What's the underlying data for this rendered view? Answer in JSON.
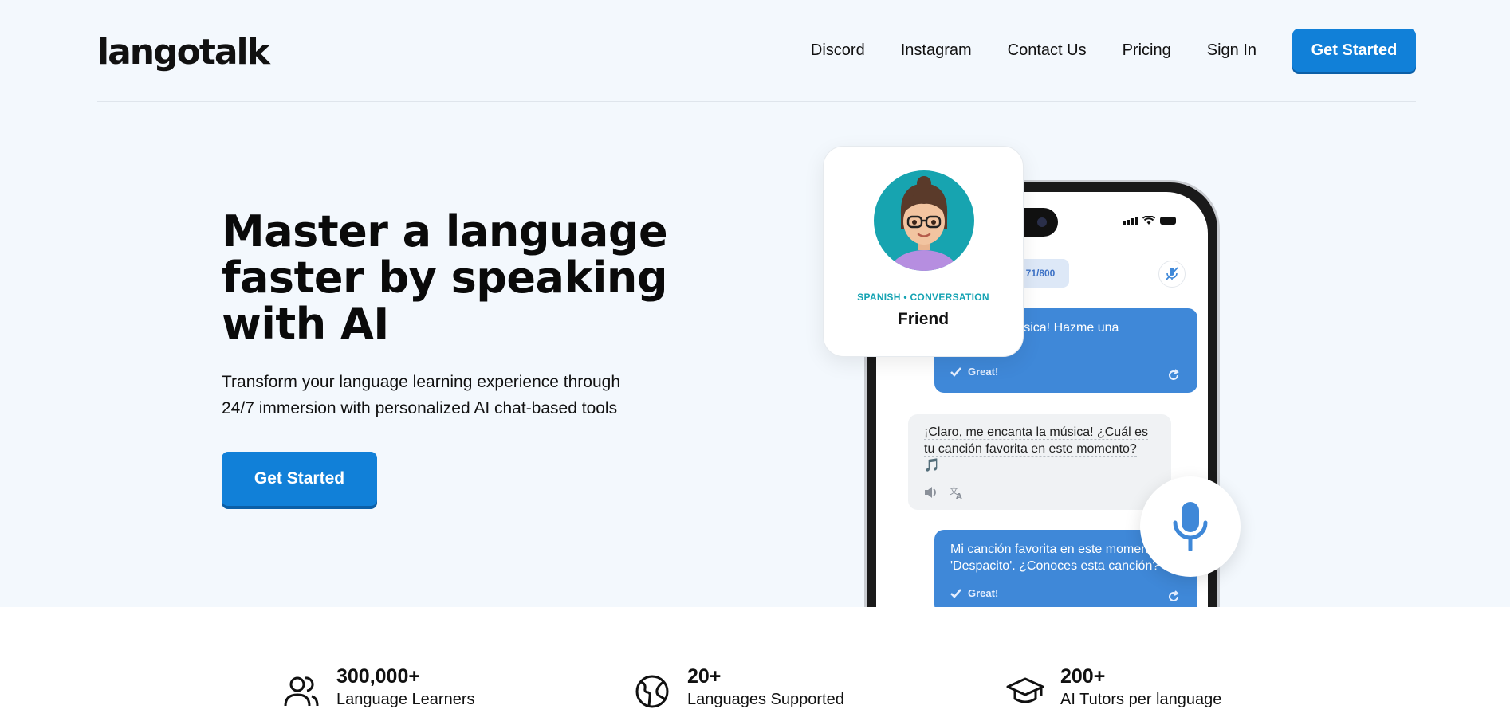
{
  "brand": {
    "logo": "langotalk"
  },
  "nav": {
    "links": [
      "Discord",
      "Instagram",
      "Contact Us",
      "Pricing",
      "Sign In"
    ],
    "cta": "Get Started"
  },
  "hero": {
    "headline": [
      "Master a language",
      "faster by speaking",
      "with AI"
    ],
    "subtitle": [
      "Transform your language learning experience through",
      "24/7 immersion with personalized AI chat-based tools"
    ],
    "cta": "Get Started"
  },
  "profile_card": {
    "tag": "SPANISH  •  CONVERSATION",
    "title": "Friend"
  },
  "phone": {
    "counter": "71/800",
    "messages": [
      {
        "role": "user",
        "text": "música! Hazme una",
        "feedback": "Great!"
      },
      {
        "role": "ai",
        "lines": [
          "¡Claro, me encanta la música! ¿Cuál es",
          "tu canción favorita en este momento?",
          "🎵"
        ]
      },
      {
        "role": "user",
        "lines": [
          "Mi canción favorita en este momen",
          "'Despacito'. ¿Conoces esta canción?"
        ],
        "feedback": "Great!"
      }
    ]
  },
  "stats": [
    {
      "value": "300,000+",
      "label": "Language Learners",
      "icon": "users-icon"
    },
    {
      "value": "20+",
      "label": "Languages Supported",
      "icon": "globe-icon"
    },
    {
      "value": "200+",
      "label": "AI Tutors per language",
      "icon": "graduation-cap-icon"
    }
  ],
  "colors": {
    "accent": "#1180d8",
    "hero_bg": "#f3f8fd",
    "user_bubble": "#3f88d8",
    "teal": "#15a3b3"
  }
}
